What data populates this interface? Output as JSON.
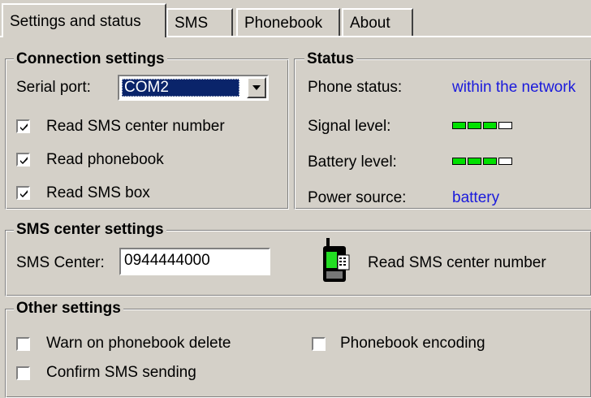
{
  "tabs": [
    {
      "label": "Settings and status",
      "active": true
    },
    {
      "label": "SMS",
      "active": false
    },
    {
      "label": "Phonebook",
      "active": false
    },
    {
      "label": "About",
      "active": false
    }
  ],
  "connection": {
    "title": "Connection settings",
    "serial_port_label": "Serial port:",
    "serial_port_value": "COM2",
    "checkboxes": [
      {
        "label": "Read SMS center number",
        "checked": true
      },
      {
        "label": "Read phonebook",
        "checked": true
      },
      {
        "label": "Read SMS box",
        "checked": true
      }
    ]
  },
  "status": {
    "title": "Status",
    "phone_status_label": "Phone status:",
    "phone_status_value": "within the network",
    "signal_label": "Signal level:",
    "signal_level": 3,
    "battery_label": "Battery level:",
    "battery_level": 3,
    "power_label": "Power source:",
    "power_value": "battery",
    "level_max": 4,
    "colors": {
      "value_text": "#1a1adc",
      "bar_on": "#00e000"
    }
  },
  "sms_center": {
    "title": "SMS center settings",
    "label": "SMS Center:",
    "value": "0944444000",
    "read_button_label": "Read SMS center number",
    "icon": "mobile-phone-icon"
  },
  "other": {
    "title": "Other settings",
    "warn_delete": {
      "label": "Warn on phonebook delete",
      "checked": false
    },
    "phonebook_encoding": {
      "label": "Phonebook encoding",
      "checked": false
    },
    "confirm_sms": {
      "label": "Confirm SMS sending",
      "checked": false
    }
  }
}
